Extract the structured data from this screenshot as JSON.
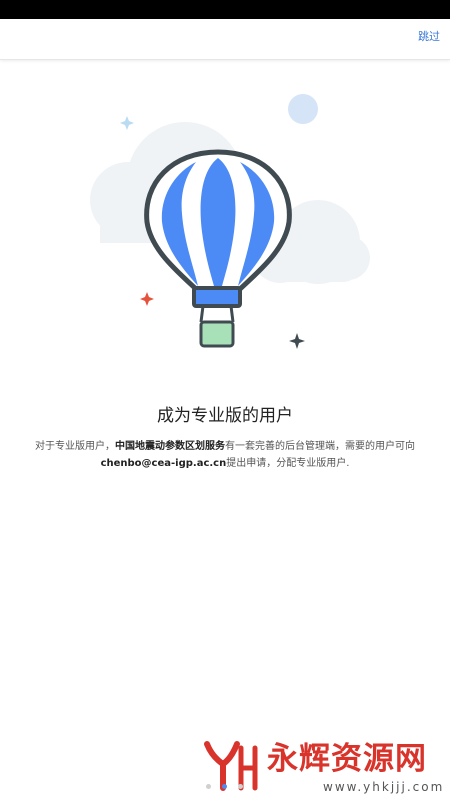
{
  "header": {
    "skip_label": "跳过"
  },
  "illustration": {
    "name": "hot-air-balloon",
    "colors": {
      "balloon_blue": "#4c8bf5",
      "outline": "#3f4b50",
      "basket_green": "#a8e0b8",
      "cloud": "#f0f3f6",
      "sparkle_red": "#e6533c",
      "sparkle_blue": "#b9dcf2",
      "sparkle_dark": "#3f4b50",
      "circle": "#d6e4f7"
    }
  },
  "content": {
    "title": "成为专业版的用户",
    "desc_prefix": "对于专业版用户，",
    "desc_service": "中国地震动参数区划服务",
    "desc_middle": "有一套完善的后台管理端，需要的用户可向",
    "desc_email": "chenbo@cea-igp.ac.cn",
    "desc_suffix": "提出申请，分配专业版用户."
  },
  "watermark": {
    "text": "永辉资源网",
    "url": "www.yhkjjj.com"
  },
  "pager": {
    "count": 3,
    "active_index": 1,
    "active_color": "#4c8bf5"
  }
}
